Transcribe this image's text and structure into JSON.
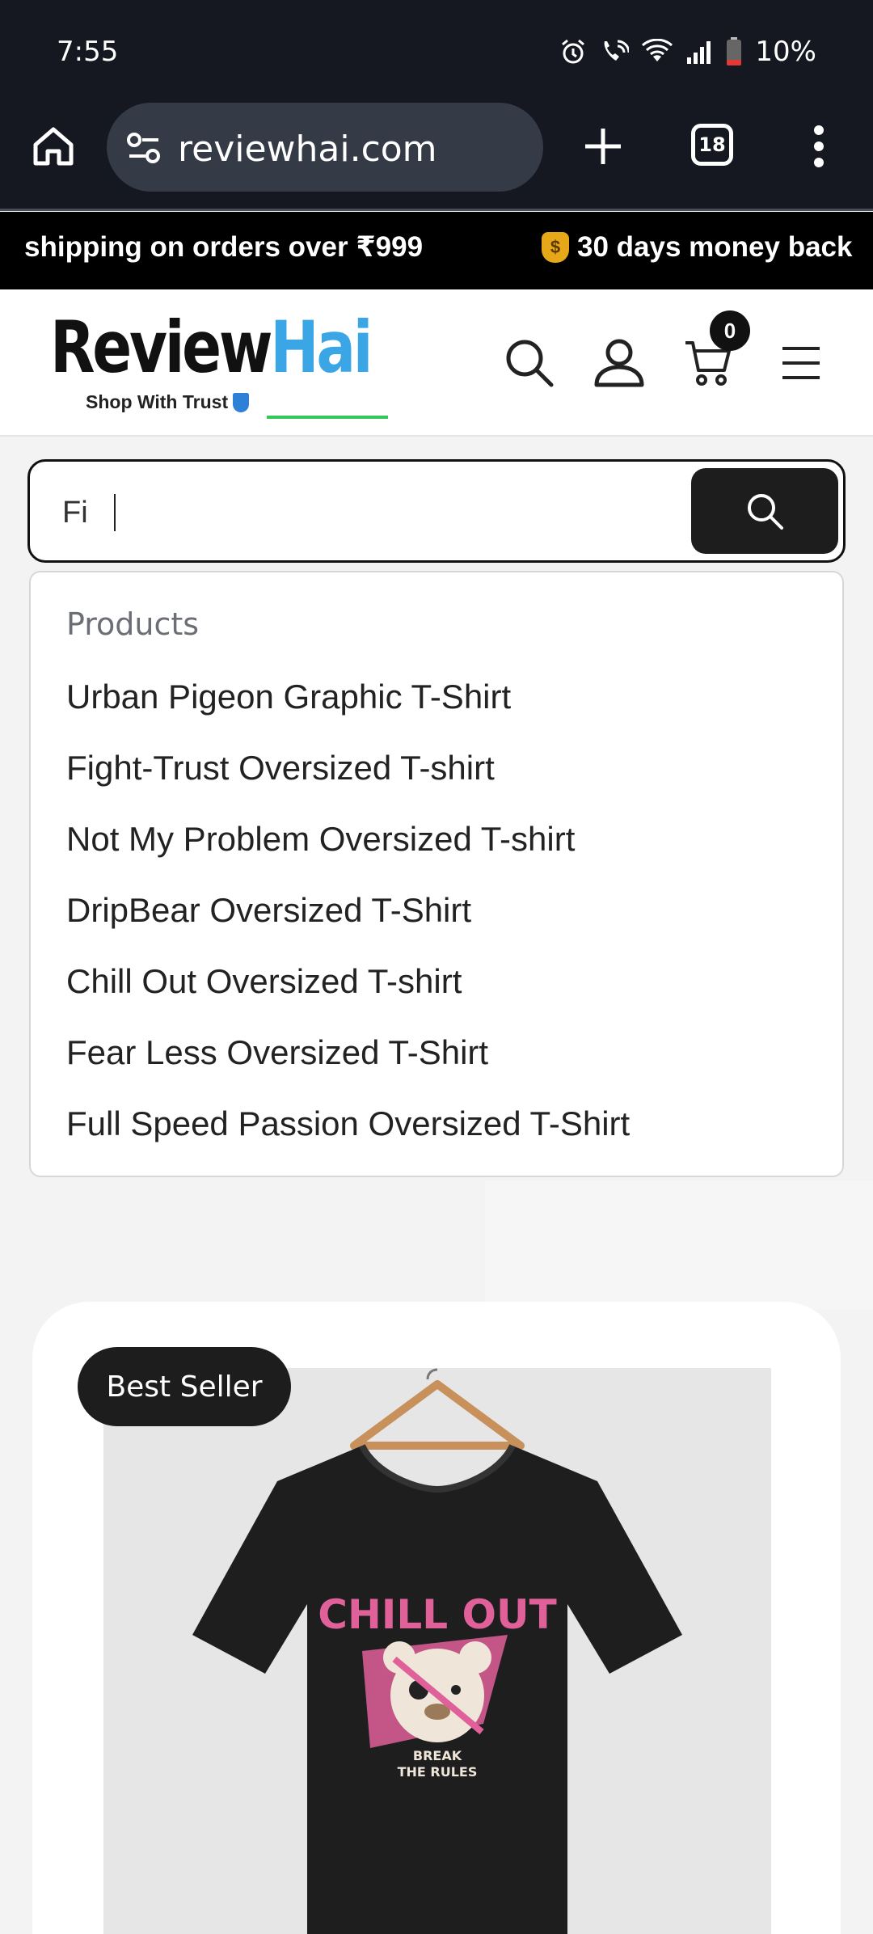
{
  "status_bar": {
    "time": "7:55",
    "battery": "10%"
  },
  "browser": {
    "url": "reviewhai.com",
    "tab_count": "18"
  },
  "announcement": {
    "item1": "shipping on orders over ₹999",
    "item2": "30 days money back"
  },
  "header": {
    "logo_part1": "Review",
    "logo_part2": "Hai",
    "tagline": "Shop With Trust",
    "cart_count": "0"
  },
  "search": {
    "value": "Fi"
  },
  "suggestions": {
    "section_title": "Products",
    "items": [
      "Urban Pigeon Graphic T-Shirt",
      "Fight-Trust Oversized T-shirt",
      "Not My Problem Oversized T-shirt",
      "DripBear Oversized T-Shirt",
      "Chill Out Oversized T-shirt",
      "Fear Less Oversized T-Shirt",
      "Full Speed Passion Oversized T-Shirt"
    ]
  },
  "product": {
    "badge": "Best Seller",
    "print_title": "CHILL OUT",
    "print_sub1": "BREAK",
    "print_sub2": "THE RULES"
  },
  "colors": {
    "browser_chrome": "#161821",
    "logo_accent": "#3aa6e6",
    "tag_underline": "#34c759",
    "dark_button": "#1d1d1d",
    "print_pink": "#e0609a"
  }
}
